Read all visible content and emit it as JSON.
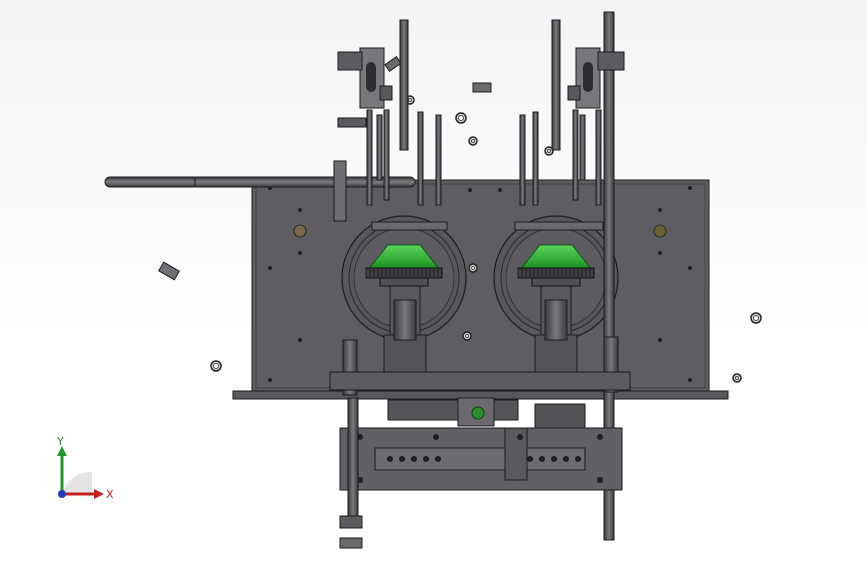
{
  "viewport": {
    "background": "#ffffff",
    "part_color": "#5f5f63",
    "edge_color": "#1c1c1e",
    "accent_green": "#23a82c",
    "accent_gold": "#8a7a3a"
  },
  "triad": {
    "x_label": "X",
    "y_label": "Y",
    "x_color": "#c41e1e",
    "y_color": "#1f9a2a",
    "z_color": "#1e3cc4"
  }
}
